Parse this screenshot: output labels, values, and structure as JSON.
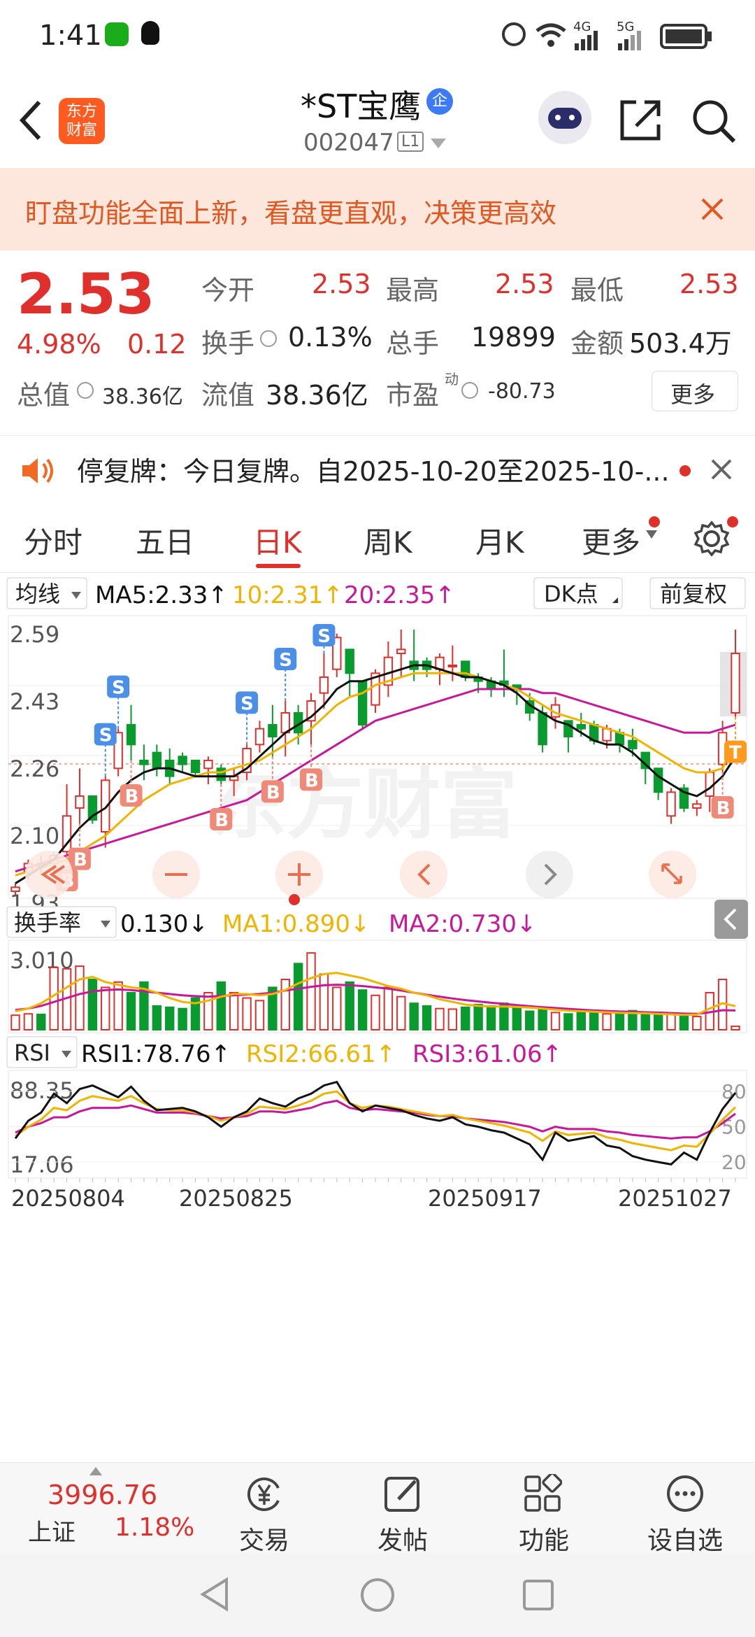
{
  "status": {
    "time": "1:41",
    "net1": "4G",
    "net2": "5G"
  },
  "nav": {
    "stock_name": "*ST宝鹰",
    "badge": "企",
    "code": "002047",
    "level": "L1",
    "logo_line1": "东方",
    "logo_line2": "财富"
  },
  "banner": {
    "text": "盯盘功能全面上新，看盘更直观，决策更高效"
  },
  "quote": {
    "price": "2.53",
    "pct": "4.98%",
    "change": "0.12",
    "open_label": "今开",
    "open": "2.53",
    "high_label": "最高",
    "high": "2.53",
    "low_label": "最低",
    "low": "2.53",
    "turnover_label": "换手",
    "turnover": "0.13%",
    "volume_label": "总手",
    "volume": "19899",
    "amount_label": "金额",
    "amount": "503.4万",
    "total_mv_label": "总值",
    "total_mv": "38.36亿",
    "float_mv_label": "流值",
    "float_mv": "38.36亿",
    "pe_label": "市盈",
    "pe_sup": "动",
    "pe": "-80.73",
    "more_button": "更多"
  },
  "notice": {
    "text": "停复牌：今日复牌。自2025-10-20至2025-10-..."
  },
  "tabs": [
    "分时",
    "五日",
    "日K",
    "周K",
    "月K",
    "更多"
  ],
  "kline_header": {
    "indicator": "均线",
    "ma5": "MA5:2.33↑",
    "ma10": "10:2.31↑",
    "ma20": "20:2.35↑",
    "dk": "DK点",
    "adjust": "前复权"
  },
  "turnover_header": {
    "indicator": "换手率",
    "value": "0.130↓",
    "ma1": "MA1:0.890↓",
    "ma2": "MA2:0.730↓"
  },
  "rsi_header": {
    "indicator": "RSI",
    "rsi1": "RSI1:78.76↑",
    "rsi2": "RSI2:66.61↑",
    "rsi3": "RSI3:61.06↑"
  },
  "colors": {
    "up": "#e0302c",
    "down": "#0a9b2e",
    "ma5": "#111111",
    "ma10": "#f0b400",
    "ma20": "#c8189a",
    "accent": "#e0302c"
  },
  "chart_data": [
    {
      "type": "candlestick",
      "price_ticks": [
        "2.59",
        "2.43",
        "2.26",
        "2.10",
        "1.93"
      ],
      "ylim": [
        1.93,
        2.59
      ],
      "ohlc": [
        [
          1.93,
          1.95,
          1.92,
          1.94
        ],
        [
          1.98,
          2.01,
          1.96,
          2.0
        ],
        [
          2.0,
          2.02,
          1.97,
          1.99
        ],
        [
          2.0,
          2.03,
          1.98,
          2.02
        ],
        [
          2.03,
          2.2,
          2.02,
          2.12
        ],
        [
          2.14,
          2.24,
          2.1,
          2.17
        ],
        [
          2.17,
          2.16,
          2.1,
          2.11
        ],
        [
          2.08,
          2.22,
          2.04,
          2.21
        ],
        [
          2.24,
          2.34,
          2.22,
          2.33
        ],
        [
          2.35,
          2.4,
          2.26,
          2.3
        ],
        [
          2.26,
          2.3,
          2.21,
          2.25
        ],
        [
          2.28,
          2.3,
          2.22,
          2.24
        ],
        [
          2.26,
          2.29,
          2.2,
          2.22
        ],
        [
          2.27,
          2.28,
          2.23,
          2.25
        ],
        [
          2.26,
          2.25,
          2.22,
          2.23
        ],
        [
          2.24,
          2.27,
          2.2,
          2.26
        ],
        [
          2.24,
          2.25,
          2.2,
          2.21
        ],
        [
          2.21,
          2.24,
          2.17,
          2.22
        ],
        [
          2.23,
          2.3,
          2.21,
          2.29
        ],
        [
          2.3,
          2.36,
          2.28,
          2.34
        ],
        [
          2.35,
          2.4,
          2.27,
          2.32
        ],
        [
          2.33,
          2.41,
          2.27,
          2.38
        ],
        [
          2.38,
          2.4,
          2.3,
          2.33
        ],
        [
          2.36,
          2.43,
          2.3,
          2.41
        ],
        [
          2.43,
          2.53,
          2.39,
          2.47
        ],
        [
          2.49,
          2.58,
          2.47,
          2.57
        ],
        [
          2.54,
          2.5,
          2.42,
          2.48
        ],
        [
          2.46,
          2.43,
          2.34,
          2.35
        ],
        [
          2.4,
          2.49,
          2.38,
          2.48
        ],
        [
          2.45,
          2.56,
          2.42,
          2.52
        ],
        [
          2.53,
          2.59,
          2.47,
          2.54
        ],
        [
          2.51,
          2.59,
          2.46,
          2.49
        ],
        [
          2.51,
          2.52,
          2.47,
          2.49
        ],
        [
          2.49,
          2.53,
          2.45,
          2.52
        ],
        [
          2.5,
          2.55,
          2.46,
          2.5
        ],
        [
          2.51,
          2.5,
          2.46,
          2.47
        ],
        [
          2.47,
          2.48,
          2.43,
          2.46
        ],
        [
          2.46,
          2.47,
          2.42,
          2.44
        ],
        [
          2.46,
          2.54,
          2.42,
          2.45
        ],
        [
          2.45,
          2.45,
          2.4,
          2.44
        ],
        [
          2.41,
          2.43,
          2.36,
          2.38
        ],
        [
          2.38,
          2.4,
          2.28,
          2.3
        ],
        [
          2.37,
          2.42,
          2.34,
          2.4
        ],
        [
          2.36,
          2.36,
          2.28,
          2.32
        ],
        [
          2.35,
          2.38,
          2.32,
          2.34
        ],
        [
          2.35,
          2.36,
          2.3,
          2.31
        ],
        [
          2.31,
          2.35,
          2.29,
          2.34
        ],
        [
          2.33,
          2.34,
          2.28,
          2.3
        ],
        [
          2.31,
          2.34,
          2.27,
          2.29
        ],
        [
          2.28,
          2.28,
          2.2,
          2.24
        ],
        [
          2.24,
          2.24,
          2.16,
          2.18
        ],
        [
          2.12,
          2.19,
          2.1,
          2.18
        ],
        [
          2.19,
          2.2,
          2.13,
          2.14
        ],
        [
          2.14,
          2.16,
          2.12,
          2.15
        ],
        [
          2.17,
          2.24,
          2.13,
          2.23
        ],
        [
          2.25,
          2.36,
          2.23,
          2.33
        ],
        [
          2.38,
          2.59,
          2.37,
          2.53
        ]
      ],
      "ma5": [
        1.95,
        1.97,
        1.99,
        2.01,
        2.05,
        2.09,
        2.12,
        2.14,
        2.18,
        2.21,
        2.23,
        2.24,
        2.24,
        2.23,
        2.22,
        2.22,
        2.22,
        2.22,
        2.24,
        2.27,
        2.3,
        2.33,
        2.35,
        2.37,
        2.4,
        2.44,
        2.46,
        2.46,
        2.47,
        2.48,
        2.49,
        2.5,
        2.5,
        2.49,
        2.48,
        2.47,
        2.47,
        2.46,
        2.45,
        2.43,
        2.4,
        2.38,
        2.36,
        2.35,
        2.33,
        2.31,
        2.3,
        2.3,
        2.28,
        2.25,
        2.22,
        2.2,
        2.18,
        2.17,
        2.19,
        2.22,
        2.27
      ],
      "ma10": [
        1.97,
        1.98,
        1.99,
        2.0,
        2.01,
        2.03,
        2.05,
        2.07,
        2.1,
        2.13,
        2.16,
        2.18,
        2.2,
        2.21,
        2.22,
        2.23,
        2.23,
        2.24,
        2.25,
        2.26,
        2.28,
        2.3,
        2.32,
        2.34,
        2.37,
        2.4,
        2.42,
        2.43,
        2.45,
        2.46,
        2.47,
        2.48,
        2.48,
        2.48,
        2.48,
        2.48,
        2.47,
        2.46,
        2.45,
        2.44,
        2.42,
        2.4,
        2.38,
        2.37,
        2.36,
        2.35,
        2.34,
        2.33,
        2.32,
        2.3,
        2.28,
        2.26,
        2.24,
        2.23,
        2.23,
        2.24,
        2.31
      ],
      "ma20": [
        1.98,
        1.99,
        2.0,
        2.01,
        2.02,
        2.03,
        2.04,
        2.05,
        2.06,
        2.07,
        2.08,
        2.09,
        2.1,
        2.11,
        2.12,
        2.13,
        2.14,
        2.15,
        2.16,
        2.18,
        2.2,
        2.22,
        2.24,
        2.26,
        2.28,
        2.3,
        2.32,
        2.34,
        2.36,
        2.37,
        2.38,
        2.39,
        2.4,
        2.41,
        2.42,
        2.43,
        2.44,
        2.44,
        2.44,
        2.44,
        2.44,
        2.43,
        2.43,
        2.42,
        2.41,
        2.4,
        2.39,
        2.38,
        2.37,
        2.36,
        2.35,
        2.34,
        2.33,
        2.33,
        2.33,
        2.34,
        2.35
      ],
      "signals": [
        {
          "i": 4,
          "type": "B"
        },
        {
          "i": 5,
          "type": "B"
        },
        {
          "i": 7,
          "type": "S"
        },
        {
          "i": 8,
          "type": "S"
        },
        {
          "i": 9,
          "type": "B"
        },
        {
          "i": 16,
          "type": "B"
        },
        {
          "i": 18,
          "type": "S"
        },
        {
          "i": 20,
          "type": "B"
        },
        {
          "i": 21,
          "type": "S"
        },
        {
          "i": 23,
          "type": "B"
        },
        {
          "i": 24,
          "type": "S"
        },
        {
          "i": 55,
          "type": "B"
        },
        {
          "i": 56,
          "type": "T"
        }
      ]
    },
    {
      "type": "bar",
      "name": "换手率",
      "max_label": "3.010",
      "ylim": [
        0,
        3.01
      ],
      "values": [
        0.55,
        0.6,
        0.58,
        2.35,
        2.3,
        2.4,
        1.9,
        1.6,
        1.8,
        1.4,
        1.8,
        0.9,
        0.85,
        0.8,
        1.2,
        1.4,
        1.8,
        1.4,
        1.2,
        1.1,
        1.6,
        1.9,
        2.5,
        2.9,
        2.1,
        1.6,
        1.8,
        1.5,
        1.3,
        1.6,
        1.25,
        1.0,
        0.9,
        0.8,
        0.78,
        0.85,
        0.95,
        0.9,
        1.0,
        0.85,
        0.7,
        0.75,
        0.65,
        0.6,
        0.7,
        0.65,
        0.6,
        0.7,
        0.72,
        0.58,
        0.55,
        0.6,
        0.55,
        0.5,
        1.4,
        1.9,
        0.13
      ],
      "ma1": [
        0.7,
        0.8,
        1.0,
        1.3,
        1.6,
        1.9,
        2.0,
        1.8,
        1.7,
        1.6,
        1.55,
        1.4,
        1.2,
        1.05,
        1.0,
        1.1,
        1.25,
        1.35,
        1.35,
        1.3,
        1.35,
        1.5,
        1.75,
        1.95,
        2.1,
        2.15,
        2.05,
        1.95,
        1.8,
        1.65,
        1.55,
        1.4,
        1.3,
        1.15,
        1.05,
        0.95,
        0.9,
        0.88,
        0.88,
        0.86,
        0.84,
        0.8,
        0.76,
        0.72,
        0.7,
        0.68,
        0.66,
        0.64,
        0.63,
        0.62,
        0.6,
        0.58,
        0.56,
        0.57,
        0.8,
        1.0,
        0.89
      ],
      "ma2": [
        0.75,
        0.8,
        0.9,
        1.05,
        1.2,
        1.35,
        1.45,
        1.5,
        1.52,
        1.5,
        1.45,
        1.4,
        1.35,
        1.3,
        1.27,
        1.25,
        1.28,
        1.3,
        1.33,
        1.35,
        1.4,
        1.48,
        1.55,
        1.62,
        1.68,
        1.7,
        1.68,
        1.65,
        1.6,
        1.55,
        1.48,
        1.4,
        1.32,
        1.25,
        1.18,
        1.12,
        1.07,
        1.02,
        0.98,
        0.93,
        0.89,
        0.85,
        0.82,
        0.79,
        0.76,
        0.73,
        0.71,
        0.69,
        0.68,
        0.66,
        0.65,
        0.63,
        0.61,
        0.6,
        0.66,
        0.74,
        0.73
      ]
    },
    {
      "type": "line",
      "name": "RSI",
      "top_label": "88.35",
      "bottom_label": "17.06",
      "right_ticks": [
        "80",
        "50",
        "20"
      ],
      "ylim": [
        17.06,
        88.35
      ],
      "x_ticks": [
        "20250804",
        "20250825",
        "20250917",
        "20251027"
      ],
      "rsi1": [
        40,
        55,
        62,
        78,
        70,
        82,
        85,
        80,
        75,
        84,
        72,
        64,
        65,
        66,
        63,
        58,
        50,
        58,
        63,
        74,
        70,
        67,
        74,
        78,
        85,
        88,
        70,
        63,
        68,
        66,
        64,
        60,
        57,
        55,
        58,
        52,
        50,
        47,
        45,
        40,
        35,
        22,
        45,
        38,
        40,
        42,
        34,
        32,
        25,
        22,
        20,
        18,
        28,
        22,
        45,
        65,
        78.76
      ],
      "rsi2": [
        42,
        50,
        56,
        66,
        64,
        72,
        76,
        74,
        72,
        76,
        70,
        65,
        64,
        64,
        62,
        59,
        55,
        58,
        61,
        67,
        66,
        65,
        68,
        72,
        78,
        80,
        70,
        66,
        68,
        67,
        65,
        63,
        61,
        59,
        60,
        57,
        55,
        53,
        51,
        48,
        45,
        38,
        46,
        43,
        44,
        45,
        41,
        39,
        36,
        34,
        32,
        30,
        34,
        33,
        44,
        56,
        66.61
      ],
      "rsi3": [
        45,
        50,
        53,
        58,
        58,
        63,
        66,
        66,
        66,
        68,
        65,
        62,
        62,
        62,
        61,
        59,
        57,
        58,
        59,
        63,
        63,
        62,
        64,
        66,
        70,
        72,
        66,
        64,
        65,
        64,
        63,
        62,
        60,
        59,
        59,
        57,
        56,
        55,
        54,
        52,
        50,
        46,
        50,
        48,
        48,
        48,
        46,
        45,
        43,
        42,
        41,
        40,
        41,
        41,
        46,
        53,
        61.06
      ]
    }
  ],
  "bottom": {
    "index_value": "3996.76",
    "index_name": "上证",
    "index_pct": "1.18%",
    "trade": "交易",
    "post": "发帖",
    "func": "功能",
    "watch": "设自选"
  }
}
